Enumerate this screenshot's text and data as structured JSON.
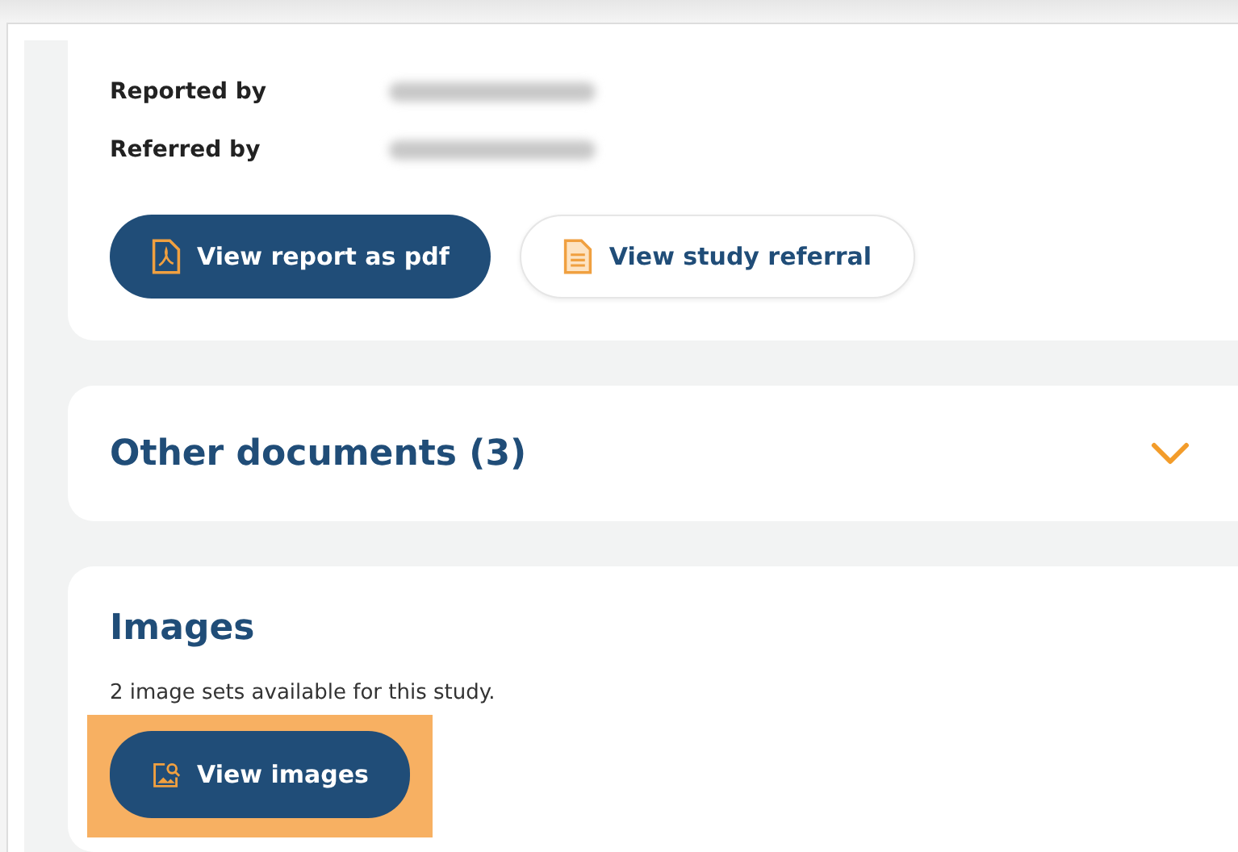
{
  "report_details": [
    {
      "label": "Reported by"
    },
    {
      "label": "Referred by"
    }
  ],
  "report_buttons": [
    {
      "label": "View report as pdf",
      "kind": "primary"
    },
    {
      "label": "View study referral",
      "kind": "secondary"
    }
  ],
  "other_documents": {
    "title": "Other documents (3)",
    "expanded": false
  },
  "images": {
    "title": "Images",
    "description": "2 image sets available for this study.",
    "button": {
      "label": "View images",
      "highlighted": true
    }
  }
}
